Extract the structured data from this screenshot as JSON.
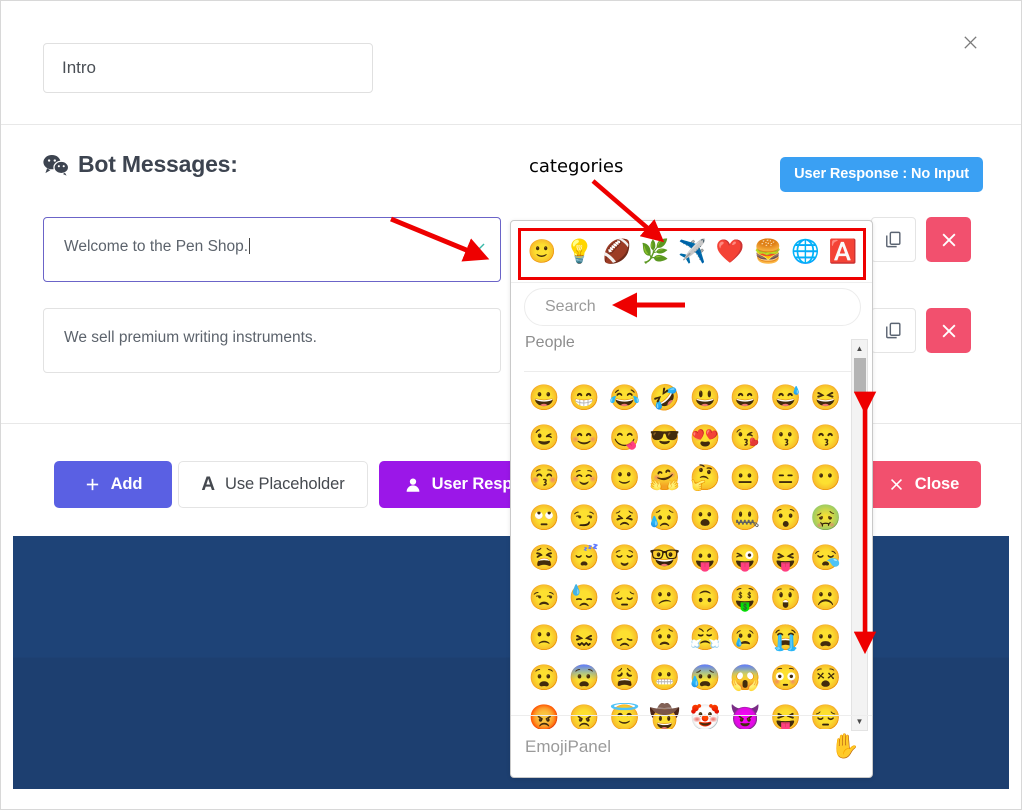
{
  "window": {
    "close_icon": "close-icon"
  },
  "title": {
    "value": "Intro",
    "placeholder": "Intro"
  },
  "bot_section": {
    "heading": "Bot Messages:",
    "heading_icon": "wechat-icon",
    "response_badge": "User Response : No Input",
    "messages": [
      {
        "text": "Welcome to the Pen Shop.",
        "focused": true,
        "clear_icon": "close-icon",
        "copy_icon": "copy-icon",
        "delete_icon": "close-icon"
      },
      {
        "text": "We sell premium writing instruments.",
        "focused": false,
        "clear_icon": "close-icon",
        "copy_icon": "copy-icon",
        "delete_icon": "close-icon"
      }
    ]
  },
  "actions": {
    "add_label": "Add",
    "add_icon": "plus-icon",
    "placeholder_label": "Use Placeholder",
    "placeholder_icon": "letter-a-icon",
    "user_response_label": "User Response",
    "user_response_icon": "user-icon",
    "close_label": "Close",
    "close_icon": "close-icon"
  },
  "emoji_panel": {
    "footer_name": "EmojiPanel",
    "footer_icon": "raised-hand-icon",
    "search_placeholder": "Search",
    "search_value": "",
    "section_label": "People",
    "categories": [
      {
        "name": "category-people",
        "glyph": "🙂"
      },
      {
        "name": "category-objects",
        "glyph": "💡"
      },
      {
        "name": "category-activity",
        "glyph": "🏈"
      },
      {
        "name": "category-nature",
        "glyph": "🌿"
      },
      {
        "name": "category-travel",
        "glyph": "✈️"
      },
      {
        "name": "category-symbols",
        "glyph": "❤️"
      },
      {
        "name": "category-food",
        "glyph": "🍔"
      },
      {
        "name": "category-flags",
        "glyph": "🌐"
      },
      {
        "name": "category-letters",
        "glyph": "🅰️"
      }
    ],
    "emojis": [
      "😀",
      "😁",
      "😂",
      "🤣",
      "😃",
      "😄",
      "😅",
      "😆",
      "😉",
      "😊",
      "😋",
      "😎",
      "😍",
      "😘",
      "😗",
      "😙",
      "😚",
      "☺️",
      "🙂",
      "🤗",
      "🤔",
      "😐",
      "😑",
      "😶",
      "🙄",
      "😏",
      "😣",
      "😥",
      "😮",
      "🤐",
      "😯",
      "🤢",
      "😫",
      "😴",
      "😌",
      "🤓",
      "😛",
      "😜",
      "😝",
      "😪",
      "😒",
      "😓",
      "😔",
      "😕",
      "🙃",
      "🤑",
      "😲",
      "☹️",
      "🙁",
      "😖",
      "😞",
      "😟",
      "😤",
      "😢",
      "😭",
      "😦",
      "😧",
      "😨",
      "😩",
      "😬",
      "😰",
      "😱",
      "😳",
      "😵",
      "😡",
      "😠",
      "😇",
      "🤠",
      "🤡",
      "😈",
      "😝",
      "😔"
    ]
  },
  "annotations": {
    "categories_label": "categories"
  }
}
